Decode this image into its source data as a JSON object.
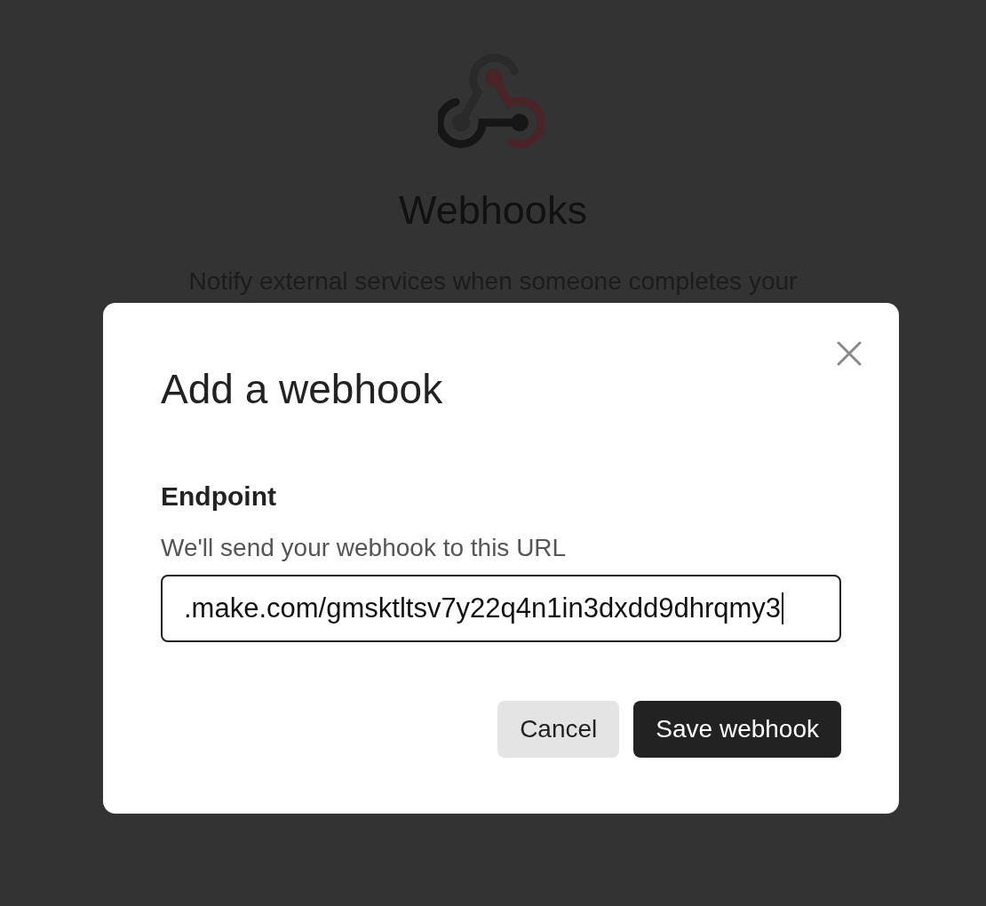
{
  "background_page": {
    "title": "Webhooks",
    "description": "Notify external services when someone completes your"
  },
  "dialog": {
    "title": "Add a webhook",
    "field": {
      "label": "Endpoint",
      "hint": "We'll send your webhook to this URL",
      "value": ".make.com/gmsktltsv7y22q4n1in3dxdd9dhrqmy3",
      "focused": true
    },
    "buttons": [
      {
        "label": "Cancel",
        "kind": "secondary"
      },
      {
        "label": "Save webhook",
        "kind": "primary"
      }
    ]
  }
}
